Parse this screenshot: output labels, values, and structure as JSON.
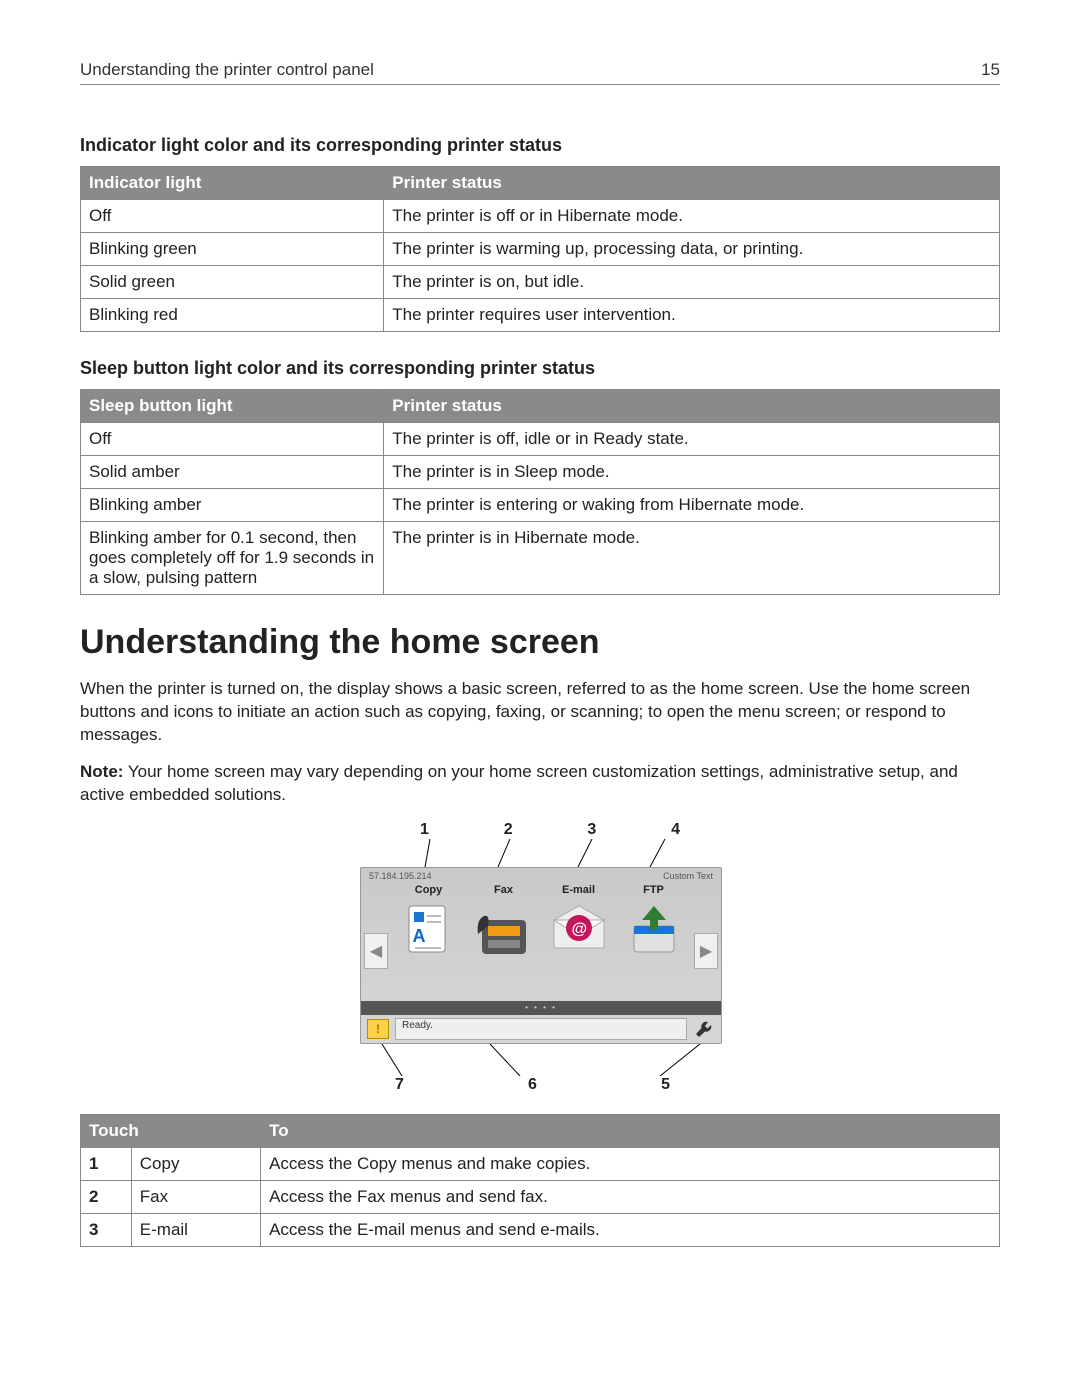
{
  "page": {
    "header_title": "Understanding the printer control panel",
    "page_number": "15"
  },
  "sec_indicator_heading": "Indicator light color and its corresponding printer status",
  "indicator_table": {
    "col1": "Indicator light",
    "col2": "Printer status",
    "rows": [
      {
        "c1": "Off",
        "c2": "The printer is off or in Hibernate mode."
      },
      {
        "c1": "Blinking green",
        "c2": "The printer is warming up, processing data, or printing."
      },
      {
        "c1": "Solid green",
        "c2": "The printer is on, but idle."
      },
      {
        "c1": "Blinking red",
        "c2": "The printer requires user intervention."
      }
    ]
  },
  "sec_sleep_heading": "Sleep button light color and its corresponding printer status",
  "sleep_table": {
    "col1": "Sleep button light",
    "col2": "Printer status",
    "rows": [
      {
        "c1": "Off",
        "c2": "The printer is off, idle or in Ready state."
      },
      {
        "c1": "Solid amber",
        "c2": "The printer is in Sleep mode."
      },
      {
        "c1": "Blinking amber",
        "c2": "The printer is entering or waking from Hibernate mode."
      },
      {
        "c1": "Blinking amber for 0.1 second, then goes completely off for 1.9 seconds in a slow, pulsing pattern",
        "c2": "The printer is in Hibernate mode."
      }
    ]
  },
  "home_screen": {
    "title": "Understanding the home screen",
    "para1": "When the printer is turned on, the display shows a basic screen, referred to as the home screen. Use the home screen buttons and icons to initiate an action such as copying, faxing, or scanning; to open the menu screen; or respond to messages.",
    "note_label": "Note:",
    "note_text": " Your home screen may vary depending on your home screen customization settings, administrative setup, and active embedded solutions."
  },
  "figure": {
    "callouts_top": [
      "1",
      "2",
      "3",
      "4"
    ],
    "callouts_bottom": [
      "7",
      "6",
      "5"
    ],
    "ip": "57.184.195.214",
    "custom": "Custom Text",
    "icons": [
      {
        "label": "Copy"
      },
      {
        "label": "Fax"
      },
      {
        "label": "E-mail"
      },
      {
        "label": "FTP"
      }
    ],
    "ready": "Ready.",
    "dots": "• • • •"
  },
  "touch_table": {
    "col1": "Touch",
    "col2": "To",
    "rows": [
      {
        "n": "1",
        "name": "Copy",
        "desc": "Access the Copy menus and make copies."
      },
      {
        "n": "2",
        "name": "Fax",
        "desc": "Access the Fax menus and send fax."
      },
      {
        "n": "3",
        "name": "E-mail",
        "desc": "Access the E-mail menus and send e-mails."
      }
    ]
  }
}
